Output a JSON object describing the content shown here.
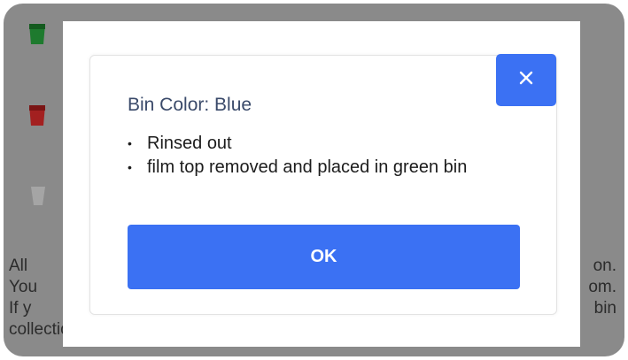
{
  "background": {
    "bin_icons": [
      {
        "name": "green-bin-icon",
        "color": "#1e7a2e"
      },
      {
        "name": "red-bin-icon",
        "color": "#a32020"
      },
      {
        "name": "gray-bin-icon",
        "color": "#9a9a9a"
      }
    ],
    "lines": [
      {
        "left": "All",
        "right": "on."
      },
      {
        "left": "You",
        "right": "om."
      },
      {
        "left": "If y",
        "right": "bin"
      },
      {
        "left": "collection.",
        "right": ""
      }
    ]
  },
  "dialog": {
    "title": "Bin Color: Blue",
    "close_icon": "close-icon",
    "items": [
      "Rinsed out",
      "film top removed and placed in green bin"
    ],
    "ok_label": "OK",
    "accent_color": "#3b71f3"
  }
}
